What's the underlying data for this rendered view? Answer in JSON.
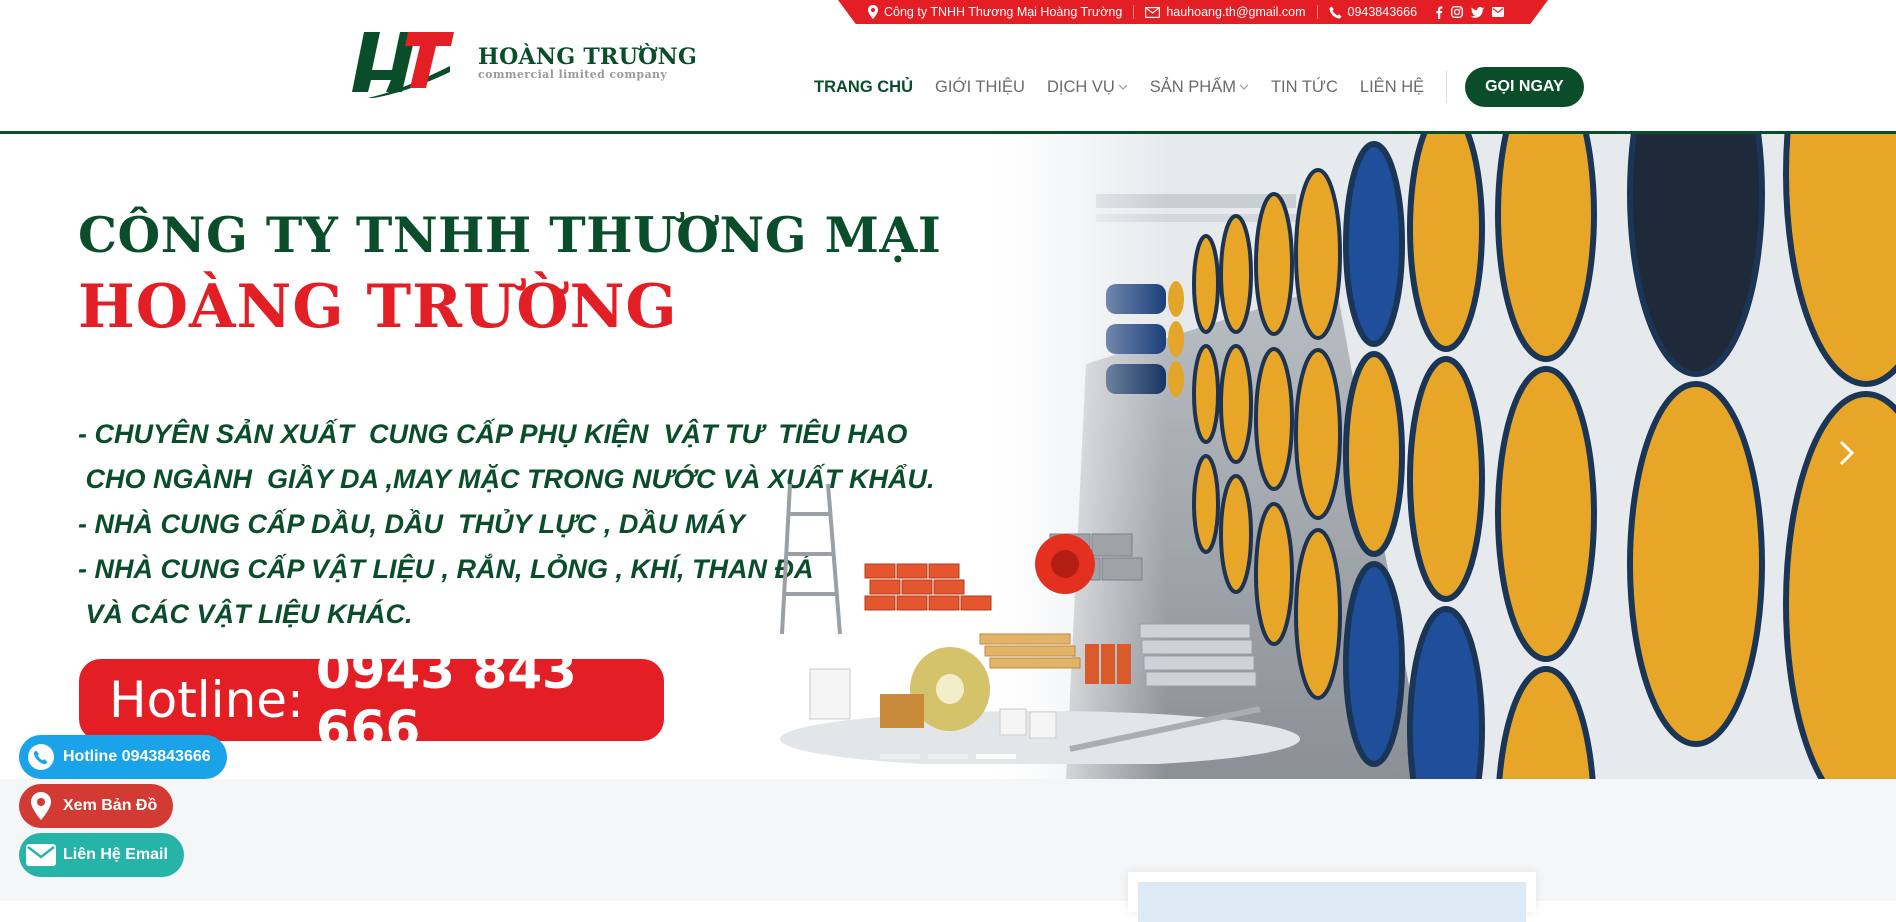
{
  "topbar": {
    "company": "Công ty TNHH Thương Mại Hoàng Trường",
    "email": "hauhoang.th@gmail.com",
    "phone": "0943843666",
    "social_icons": [
      "facebook-icon",
      "instagram-icon",
      "twitter-icon",
      "envelope-icon"
    ]
  },
  "logo": {
    "name": "HOÀNG TRƯỜNG",
    "subtitle": "commercial limited company",
    "colors": {
      "green": "#0a4d2a",
      "red": "#e31e24"
    }
  },
  "nav": {
    "items": [
      {
        "label": "TRANG CHỦ",
        "active": true
      },
      {
        "label": "GIỚI THIỆU"
      },
      {
        "label": "DỊCH VỤ",
        "dropdown": true
      },
      {
        "label": "SẢN PHẨM",
        "dropdown": true
      },
      {
        "label": "TIN TỨC"
      },
      {
        "label": "LIÊN HỆ"
      }
    ],
    "cta": "GỌI NGAY"
  },
  "hero": {
    "title_line1": "CÔNG TY TNHH THƯƠNG MẠI",
    "title_line2": "HOÀNG TRƯỜNG",
    "lines": [
      "- CHUYÊN SẢN XUẤT  CUNG CẤP PHỤ KIỆN  VẬT TƯ  TIÊU HAO",
      " CHO NGÀNH  GIẦY DA ,MAY MẶC TRONG NƯỚC VÀ XUẤT KHẨU.",
      "- NHÀ CUNG CẤP DẦU, DẦU  THỦY LỰC , DẦU MÁY",
      "- NHÀ CUNG CẤP VẬT LIỆU , RẮN, LỎNG , KHÍ, THAN ĐÁ",
      " VÀ CÁC VẬT LIỆU KHÁC."
    ],
    "hotline_label": "Hotline:",
    "hotline_number": "0943 843 666",
    "slides": 3,
    "active_slide": 3
  },
  "floating": {
    "hotline": "Hotline 0943843666",
    "map": "Xem Bản Đồ",
    "email": "Liên Hệ Email"
  }
}
